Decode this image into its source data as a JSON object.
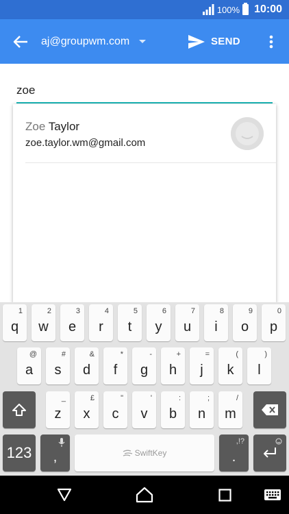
{
  "status_bar": {
    "battery": "100%",
    "time": "10:00"
  },
  "app_bar": {
    "account": "aj@groupwm.com",
    "send_label": "SEND"
  },
  "compose": {
    "to_value": "zoe"
  },
  "suggestions": [
    {
      "name_match": "Zoe",
      "name_rest": " Taylor",
      "email": "zoe.taylor.wm@gmail.com"
    }
  ],
  "keyboard": {
    "row1": [
      {
        "label": "q",
        "alt": "1"
      },
      {
        "label": "w",
        "alt": "2"
      },
      {
        "label": "e",
        "alt": "3"
      },
      {
        "label": "r",
        "alt": "4"
      },
      {
        "label": "t",
        "alt": "5"
      },
      {
        "label": "y",
        "alt": "6"
      },
      {
        "label": "u",
        "alt": "7"
      },
      {
        "label": "i",
        "alt": "8"
      },
      {
        "label": "o",
        "alt": "9"
      },
      {
        "label": "p",
        "alt": "0"
      }
    ],
    "row2": [
      {
        "label": "a",
        "alt": "@"
      },
      {
        "label": "s",
        "alt": "#"
      },
      {
        "label": "d",
        "alt": "&"
      },
      {
        "label": "f",
        "alt": "*"
      },
      {
        "label": "g",
        "alt": "-"
      },
      {
        "label": "h",
        "alt": "+"
      },
      {
        "label": "j",
        "alt": "="
      },
      {
        "label": "k",
        "alt": "("
      },
      {
        "label": "l",
        "alt": ")"
      }
    ],
    "row3": [
      {
        "label": "z",
        "alt": "_"
      },
      {
        "label": "x",
        "alt": "£"
      },
      {
        "label": "c",
        "alt": "\""
      },
      {
        "label": "v",
        "alt": "'"
      },
      {
        "label": "b",
        "alt": ":"
      },
      {
        "label": "n",
        "alt": ";"
      },
      {
        "label": "m",
        "alt": "/"
      }
    ],
    "numbers_label": "123",
    "comma": ",",
    "period": ".",
    "period_alt": ",!?",
    "space_brand": "SwiftKey"
  }
}
